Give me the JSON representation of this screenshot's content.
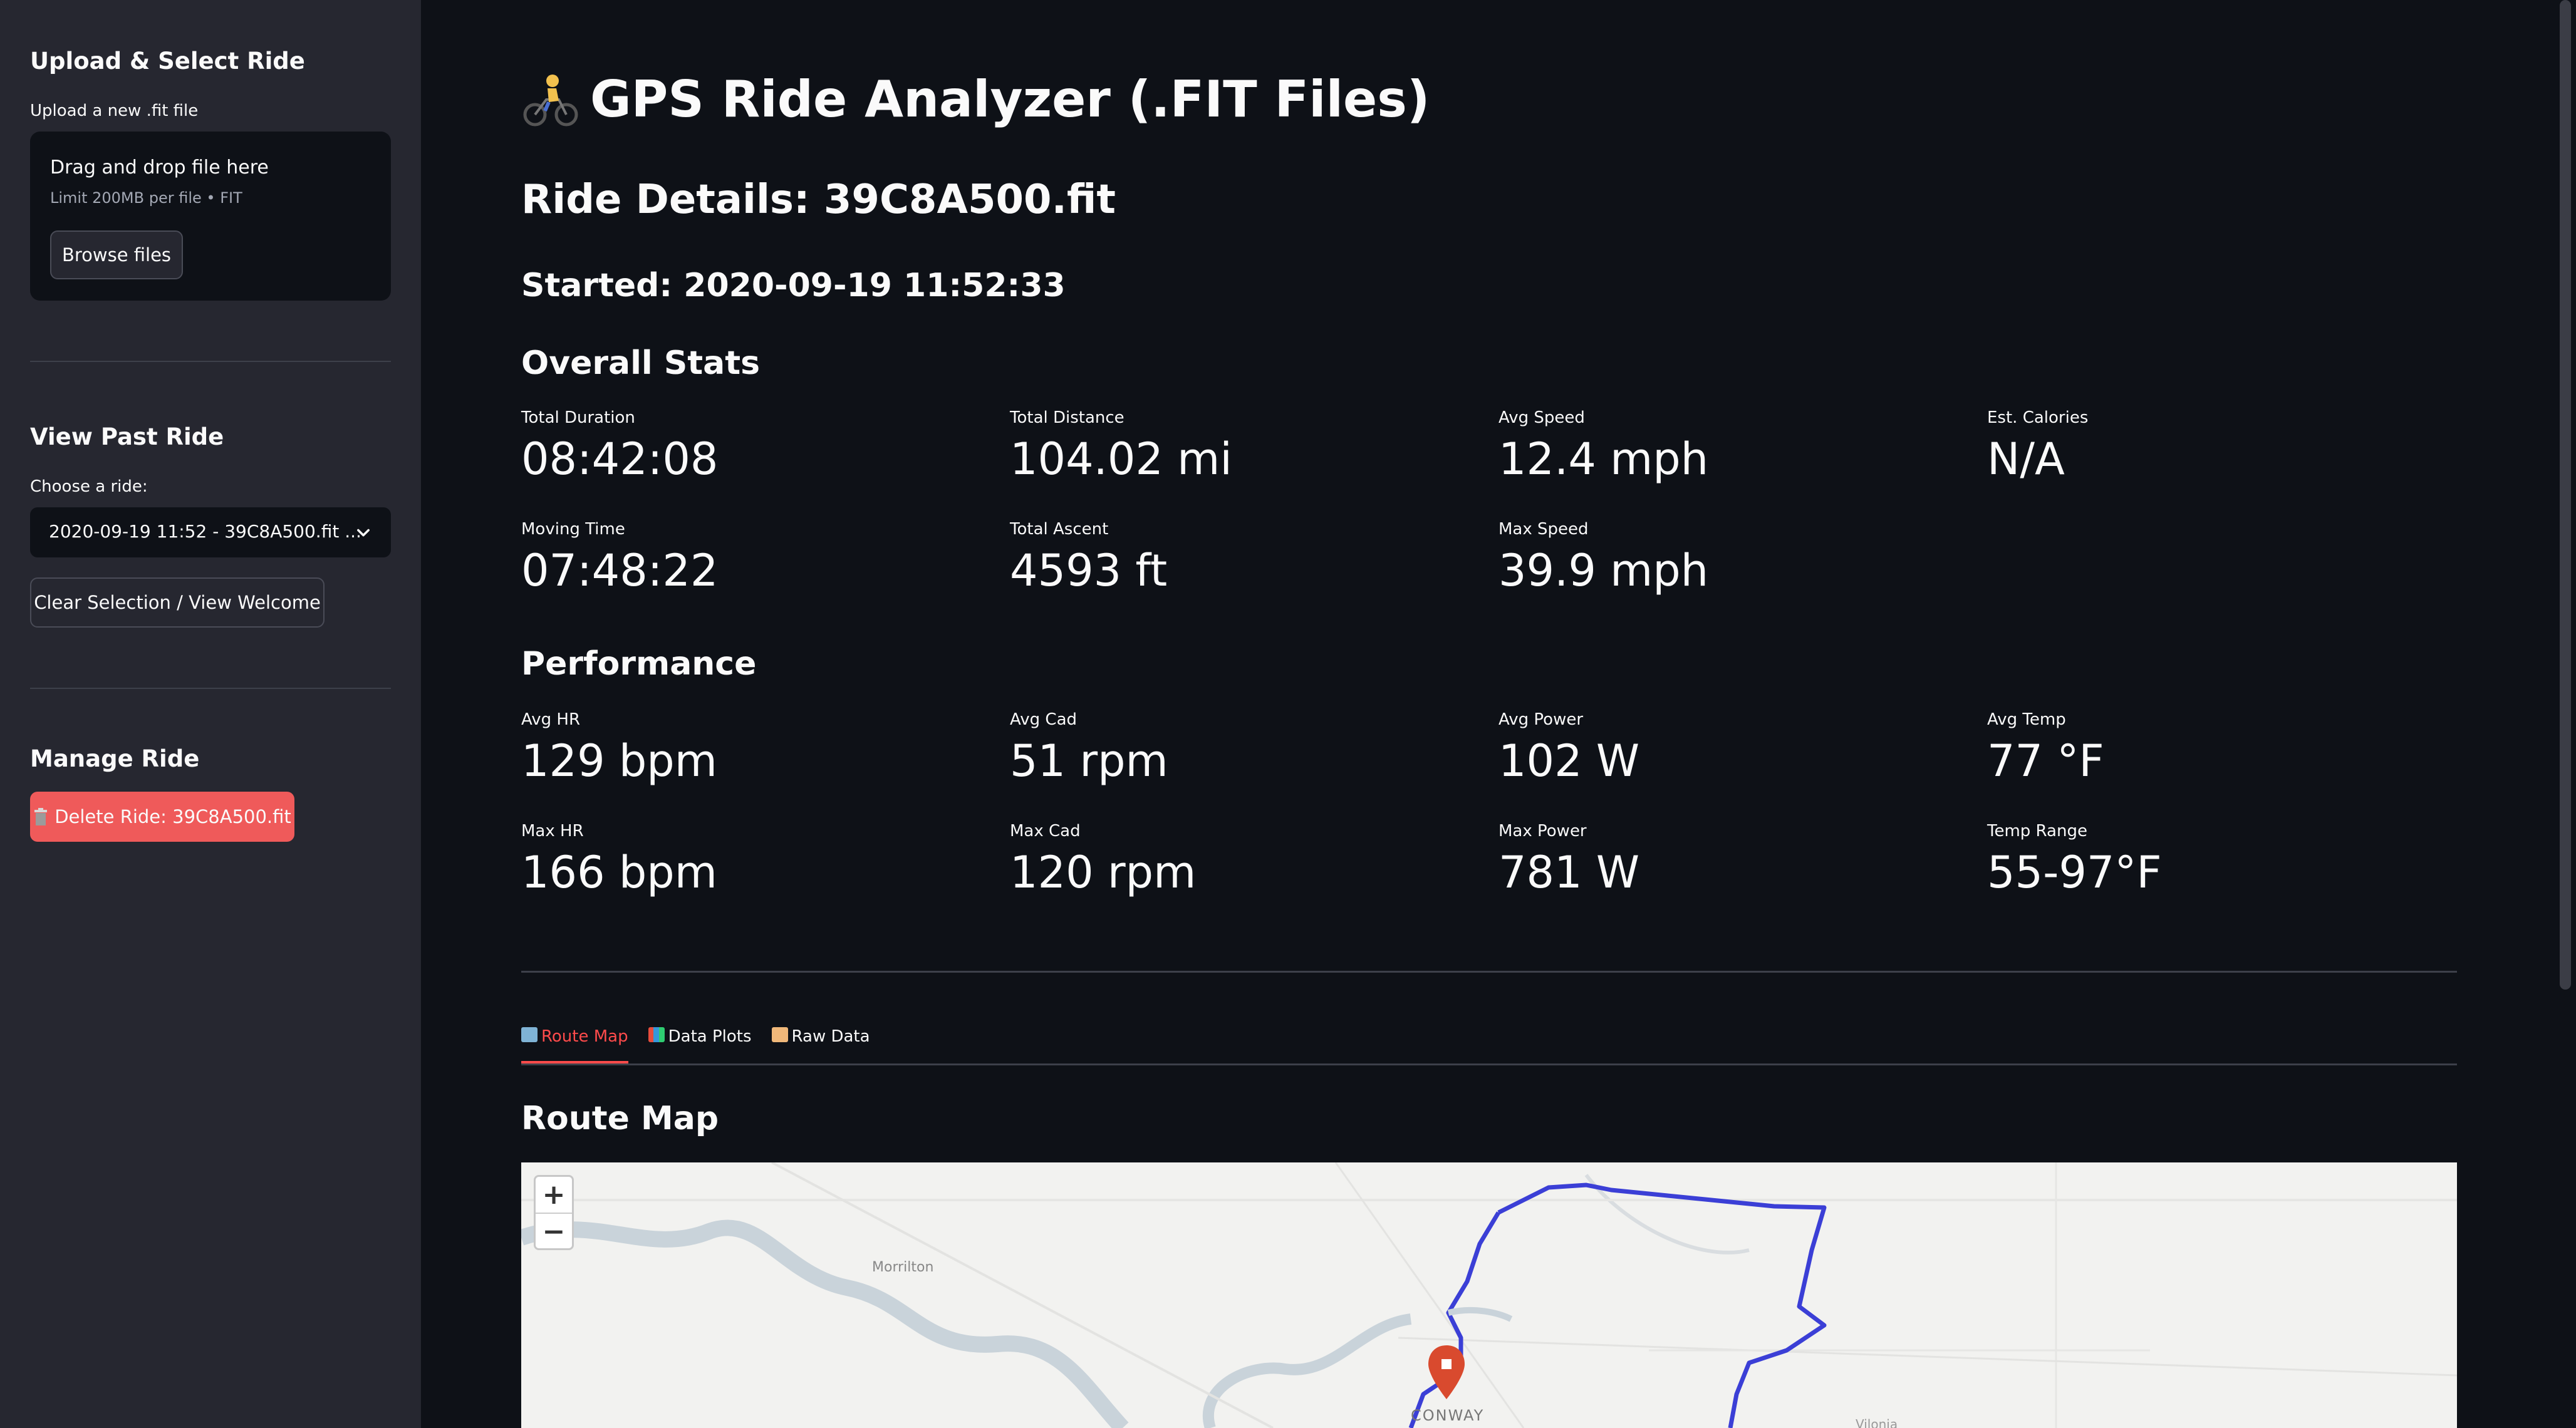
{
  "sidebar": {
    "upload_heading": "Upload & Select Ride",
    "upload_label": "Upload a new .fit file",
    "dropzone_title": "Drag and drop file here",
    "dropzone_sub": "Limit 200MB per file • FIT",
    "browse_label": "Browse files",
    "past_heading": "View Past Ride",
    "choose_label": "Choose a ride:",
    "selected_ride": "2020-09-19 11:52 - 39C8A500.fit ...",
    "clear_label": "Clear Selection / View Welcome",
    "manage_heading": "Manage Ride",
    "delete_label": "Delete Ride: 39C8A500.fit"
  },
  "main": {
    "title": "GPS Ride Analyzer (.FIT Files)",
    "ride_details": "Ride Details: 39C8A500.fit",
    "started": "Started: 2020-09-19 11:52:33",
    "overall_heading": "Overall Stats",
    "performance_heading": "Performance",
    "overall": [
      {
        "label": "Total Duration",
        "value": "08:42:08"
      },
      {
        "label": "Total Distance",
        "value": "104.02 mi"
      },
      {
        "label": "Avg Speed",
        "value": "12.4 mph"
      },
      {
        "label": "Est. Calories",
        "value": "N/A"
      },
      {
        "label": "Moving Time",
        "value": "07:48:22"
      },
      {
        "label": "Total Ascent",
        "value": "4593 ft"
      },
      {
        "label": "Max Speed",
        "value": "39.9 mph"
      }
    ],
    "performance": [
      {
        "label": "Avg HR",
        "value": "129 bpm"
      },
      {
        "label": "Avg Cad",
        "value": "51 rpm"
      },
      {
        "label": "Avg Power",
        "value": "102 W"
      },
      {
        "label": "Avg Temp",
        "value": "77 °F"
      },
      {
        "label": "Max HR",
        "value": "166 bpm"
      },
      {
        "label": "Max Cad",
        "value": "120 rpm"
      },
      {
        "label": "Max Power",
        "value": "781 W"
      },
      {
        "label": "Temp Range",
        "value": "55-97°F"
      }
    ],
    "tabs": [
      {
        "label": "Route Map",
        "icon": "map-icon"
      },
      {
        "label": "Data Plots",
        "icon": "bar-chart-icon"
      },
      {
        "label": "Raw Data",
        "icon": "folder-icon"
      }
    ],
    "route_map_heading": "Route Map",
    "map": {
      "zoom_in": "+",
      "zoom_out": "−",
      "places": [
        "Morrilton",
        "CONWAY",
        "Vilonia"
      ]
    }
  },
  "colors": {
    "accent": "#ff4b4b",
    "route": "#3b3fd6",
    "delete_button": "#ef5a5a"
  }
}
